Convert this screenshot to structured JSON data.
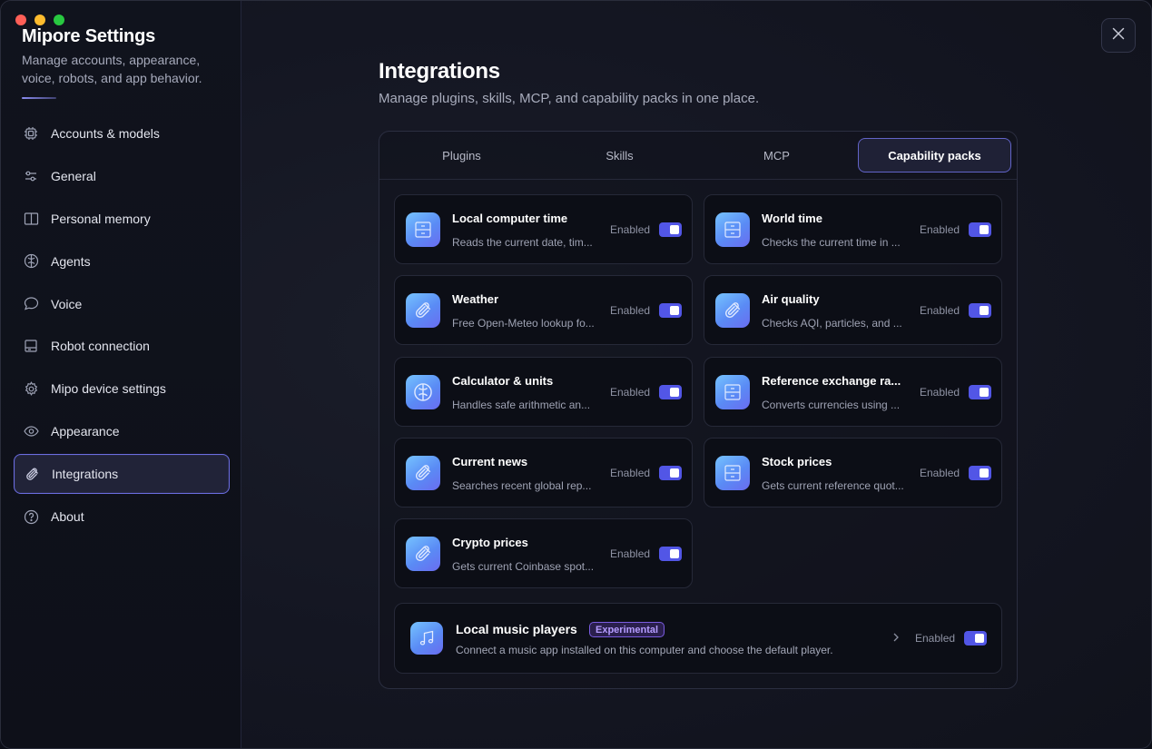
{
  "app": {
    "title": "Mipore Settings",
    "subtitle": "Manage accounts, appearance, voice, robots, and app behavior."
  },
  "sidebar": {
    "items": [
      {
        "label": "Accounts & models",
        "icon": "chip-icon"
      },
      {
        "label": "General",
        "icon": "sliders-icon"
      },
      {
        "label": "Personal memory",
        "icon": "book-icon"
      },
      {
        "label": "Agents",
        "icon": "brain-icon"
      },
      {
        "label": "Voice",
        "icon": "chat-bubble-icon"
      },
      {
        "label": "Robot connection",
        "icon": "device-icon"
      },
      {
        "label": "Mipo device settings",
        "icon": "gear-icon"
      },
      {
        "label": "Appearance",
        "icon": "eye-icon"
      },
      {
        "label": "Integrations",
        "icon": "paperclip-icon",
        "active": true
      },
      {
        "label": "About",
        "icon": "question-icon"
      }
    ]
  },
  "main": {
    "title": "Integrations",
    "subtitle": "Manage plugins, skills, MCP, and capability packs in one place.",
    "tabs": [
      {
        "label": "Plugins"
      },
      {
        "label": "Skills"
      },
      {
        "label": "MCP"
      },
      {
        "label": "Capability packs",
        "active": true
      }
    ],
    "cards": [
      {
        "title": "Local computer time",
        "desc": "Reads the current date, tim...",
        "status": "Enabled",
        "icon": "archive-icon"
      },
      {
        "title": "World time",
        "desc": "Checks the current time in ...",
        "status": "Enabled",
        "icon": "archive-icon"
      },
      {
        "title": "Weather",
        "desc": "Free Open-Meteo lookup fo...",
        "status": "Enabled",
        "icon": "paperclip-icon"
      },
      {
        "title": "Air quality",
        "desc": "Checks AQI, particles, and ...",
        "status": "Enabled",
        "icon": "paperclip-icon"
      },
      {
        "title": "Calculator & units",
        "desc": "Handles safe arithmetic an...",
        "status": "Enabled",
        "icon": "brain-icon"
      },
      {
        "title": "Reference exchange ra...",
        "desc": "Converts currencies using ...",
        "status": "Enabled",
        "icon": "archive-icon"
      },
      {
        "title": "Current news",
        "desc": "Searches recent global rep...",
        "status": "Enabled",
        "icon": "paperclip-icon"
      },
      {
        "title": "Stock prices",
        "desc": "Gets current reference quot...",
        "status": "Enabled",
        "icon": "archive-icon"
      },
      {
        "title": "Crypto prices",
        "desc": "Gets current Coinbase spot...",
        "status": "Enabled",
        "icon": "paperclip-icon"
      }
    ],
    "wide_card": {
      "title": "Local music players",
      "badge": "Experimental",
      "desc": "Connect a music app installed on this computer and choose the default player.",
      "status": "Enabled",
      "icon": "music-note-icon"
    }
  },
  "colors": {
    "accent": "#5256e6",
    "badge": "#b59cff"
  }
}
